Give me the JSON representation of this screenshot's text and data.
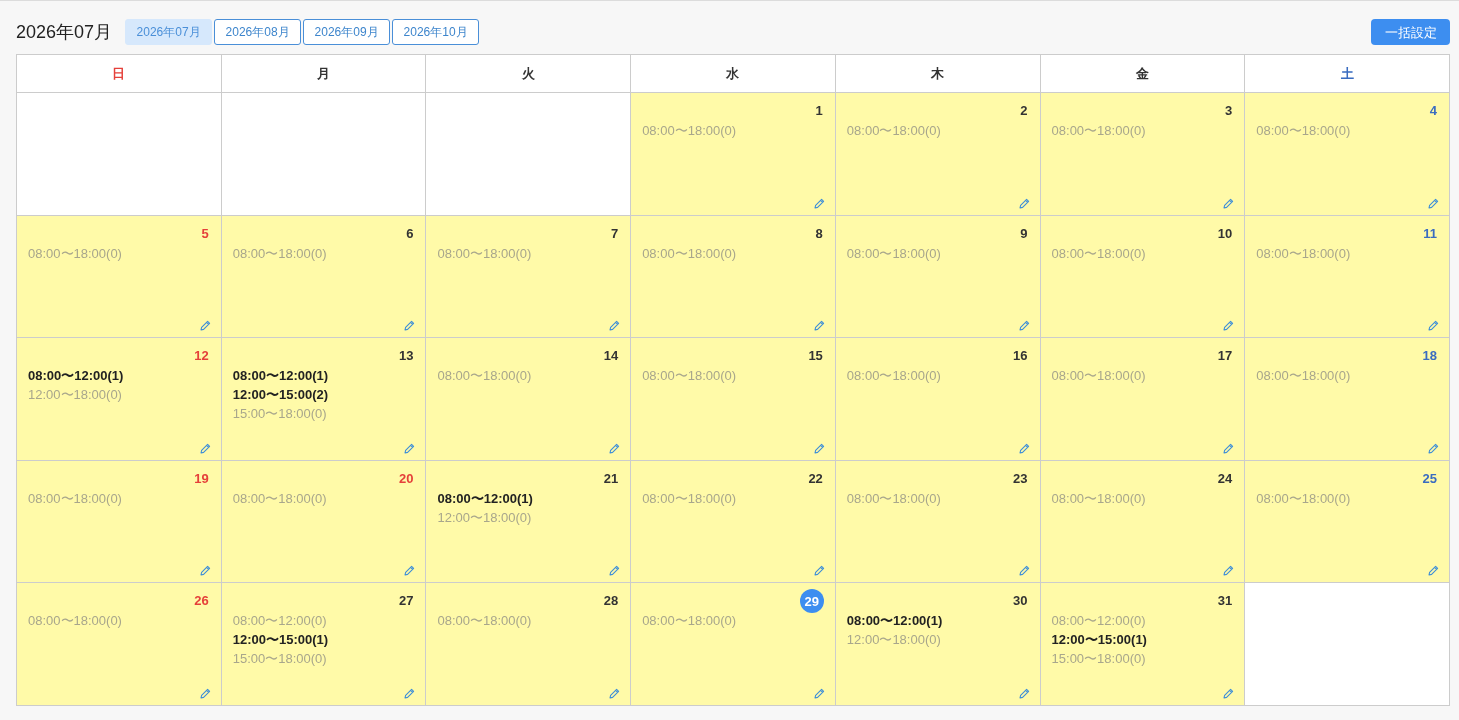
{
  "title": "2026年07月",
  "month_tabs": [
    {
      "label": "2026年07月",
      "selected": true
    },
    {
      "label": "2026年08月",
      "selected": false
    },
    {
      "label": "2026年09月",
      "selected": false
    },
    {
      "label": "2026年10月",
      "selected": false
    }
  ],
  "bulk_button": "一括設定",
  "calendar": {
    "weekdays": [
      {
        "label": "日",
        "kind": "sunday"
      },
      {
        "label": "月",
        "kind": "weekday"
      },
      {
        "label": "火",
        "kind": "weekday"
      },
      {
        "label": "水",
        "kind": "weekday"
      },
      {
        "label": "木",
        "kind": "weekday"
      },
      {
        "label": "金",
        "kind": "weekday"
      },
      {
        "label": "土",
        "kind": "saturday"
      }
    ],
    "weeks": [
      [
        {
          "kind": "blank"
        },
        {
          "kind": "blank"
        },
        {
          "kind": "blank"
        },
        {
          "kind": "weekday",
          "day": "1",
          "today": false,
          "slots": [
            {
              "text": "08:00〜18:00(0)",
              "booked": false
            }
          ]
        },
        {
          "kind": "weekday",
          "day": "2",
          "today": false,
          "slots": [
            {
              "text": "08:00〜18:00(0)",
              "booked": false
            }
          ]
        },
        {
          "kind": "weekday",
          "day": "3",
          "today": false,
          "slots": [
            {
              "text": "08:00〜18:00(0)",
              "booked": false
            }
          ]
        },
        {
          "kind": "saturday",
          "day": "4",
          "today": false,
          "slots": [
            {
              "text": "08:00〜18:00(0)",
              "booked": false
            }
          ]
        }
      ],
      [
        {
          "kind": "sunday",
          "day": "5",
          "today": false,
          "slots": [
            {
              "text": "08:00〜18:00(0)",
              "booked": false
            }
          ]
        },
        {
          "kind": "weekday",
          "day": "6",
          "today": false,
          "slots": [
            {
              "text": "08:00〜18:00(0)",
              "booked": false
            }
          ]
        },
        {
          "kind": "weekday",
          "day": "7",
          "today": false,
          "slots": [
            {
              "text": "08:00〜18:00(0)",
              "booked": false
            }
          ]
        },
        {
          "kind": "weekday",
          "day": "8",
          "today": false,
          "slots": [
            {
              "text": "08:00〜18:00(0)",
              "booked": false
            }
          ]
        },
        {
          "kind": "weekday",
          "day": "9",
          "today": false,
          "slots": [
            {
              "text": "08:00〜18:00(0)",
              "booked": false
            }
          ]
        },
        {
          "kind": "weekday",
          "day": "10",
          "today": false,
          "slots": [
            {
              "text": "08:00〜18:00(0)",
              "booked": false
            }
          ]
        },
        {
          "kind": "saturday",
          "day": "11",
          "today": false,
          "slots": [
            {
              "text": "08:00〜18:00(0)",
              "booked": false
            }
          ]
        }
      ],
      [
        {
          "kind": "sunday",
          "day": "12",
          "today": false,
          "slots": [
            {
              "text": "08:00〜12:00(1)",
              "booked": true
            },
            {
              "text": "12:00〜18:00(0)",
              "booked": false
            }
          ]
        },
        {
          "kind": "weekday",
          "day": "13",
          "today": false,
          "slots": [
            {
              "text": "08:00〜12:00(1)",
              "booked": true
            },
            {
              "text": "12:00〜15:00(2)",
              "booked": true
            },
            {
              "text": "15:00〜18:00(0)",
              "booked": false
            }
          ]
        },
        {
          "kind": "weekday",
          "day": "14",
          "today": false,
          "slots": [
            {
              "text": "08:00〜18:00(0)",
              "booked": false
            }
          ]
        },
        {
          "kind": "weekday",
          "day": "15",
          "today": false,
          "slots": [
            {
              "text": "08:00〜18:00(0)",
              "booked": false
            }
          ]
        },
        {
          "kind": "weekday",
          "day": "16",
          "today": false,
          "slots": [
            {
              "text": "08:00〜18:00(0)",
              "booked": false
            }
          ]
        },
        {
          "kind": "weekday",
          "day": "17",
          "today": false,
          "slots": [
            {
              "text": "08:00〜18:00(0)",
              "booked": false
            }
          ]
        },
        {
          "kind": "saturday",
          "day": "18",
          "today": false,
          "slots": [
            {
              "text": "08:00〜18:00(0)",
              "booked": false
            }
          ]
        }
      ],
      [
        {
          "kind": "sunday",
          "day": "19",
          "today": false,
          "slots": [
            {
              "text": "08:00〜18:00(0)",
              "booked": false
            }
          ]
        },
        {
          "kind": "holiday",
          "day": "20",
          "today": false,
          "slots": [
            {
              "text": "08:00〜18:00(0)",
              "booked": false
            }
          ]
        },
        {
          "kind": "weekday",
          "day": "21",
          "today": false,
          "slots": [
            {
              "text": "08:00〜12:00(1)",
              "booked": true
            },
            {
              "text": "12:00〜18:00(0)",
              "booked": false
            }
          ]
        },
        {
          "kind": "weekday",
          "day": "22",
          "today": false,
          "slots": [
            {
              "text": "08:00〜18:00(0)",
              "booked": false
            }
          ]
        },
        {
          "kind": "weekday",
          "day": "23",
          "today": false,
          "slots": [
            {
              "text": "08:00〜18:00(0)",
              "booked": false
            }
          ]
        },
        {
          "kind": "weekday",
          "day": "24",
          "today": false,
          "slots": [
            {
              "text": "08:00〜18:00(0)",
              "booked": false
            }
          ]
        },
        {
          "kind": "saturday",
          "day": "25",
          "today": false,
          "slots": [
            {
              "text": "08:00〜18:00(0)",
              "booked": false
            }
          ]
        }
      ],
      [
        {
          "kind": "sunday",
          "day": "26",
          "today": false,
          "slots": [
            {
              "text": "08:00〜18:00(0)",
              "booked": false
            }
          ]
        },
        {
          "kind": "weekday",
          "day": "27",
          "today": false,
          "slots": [
            {
              "text": "08:00〜12:00(0)",
              "booked": false
            },
            {
              "text": "12:00〜15:00(1)",
              "booked": true
            },
            {
              "text": "15:00〜18:00(0)",
              "booked": false
            }
          ]
        },
        {
          "kind": "weekday",
          "day": "28",
          "today": false,
          "slots": [
            {
              "text": "08:00〜18:00(0)",
              "booked": false
            }
          ]
        },
        {
          "kind": "weekday",
          "day": "29",
          "today": true,
          "slots": [
            {
              "text": "08:00〜18:00(0)",
              "booked": false
            }
          ]
        },
        {
          "kind": "weekday",
          "day": "30",
          "today": false,
          "slots": [
            {
              "text": "08:00〜12:00(1)",
              "booked": true
            },
            {
              "text": "12:00〜18:00(0)",
              "booked": false
            }
          ]
        },
        {
          "kind": "weekday",
          "day": "31",
          "today": false,
          "slots": [
            {
              "text": "08:00〜12:00(0)",
              "booked": false
            },
            {
              "text": "12:00〜15:00(1)",
              "booked": true
            },
            {
              "text": "15:00〜18:00(0)",
              "booked": false
            }
          ]
        },
        {
          "kind": "blank"
        }
      ]
    ]
  }
}
